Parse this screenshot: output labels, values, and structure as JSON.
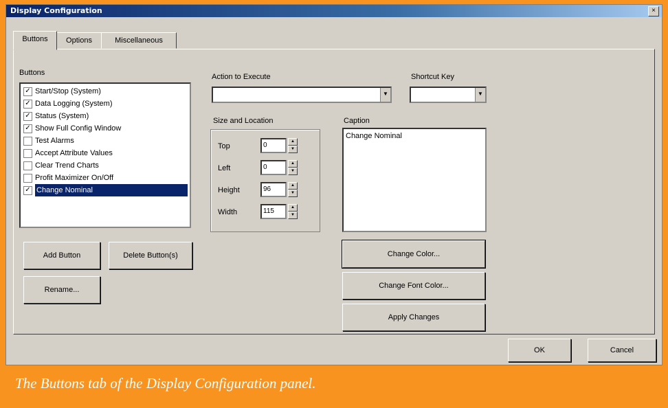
{
  "window": {
    "title": "Display Configuration",
    "close_glyph": "×"
  },
  "tabs": [
    {
      "label": "Buttons",
      "active": true
    },
    {
      "label": "Options",
      "active": false
    },
    {
      "label": "Miscellaneous",
      "active": false
    }
  ],
  "buttons_list": {
    "label": "Buttons",
    "items": [
      {
        "label": "Start/Stop (System)",
        "checked": true,
        "selected": false
      },
      {
        "label": "Data Logging (System)",
        "checked": true,
        "selected": false
      },
      {
        "label": "Status (System)",
        "checked": true,
        "selected": false
      },
      {
        "label": "Show Full Config Window",
        "checked": true,
        "selected": false
      },
      {
        "label": "Test Alarms",
        "checked": false,
        "selected": false
      },
      {
        "label": "Accept Attribute Values",
        "checked": false,
        "selected": false
      },
      {
        "label": "Clear Trend Charts",
        "checked": false,
        "selected": false
      },
      {
        "label": "Profit Maximizer On/Off",
        "checked": false,
        "selected": false
      },
      {
        "label": "Change Nominal",
        "checked": true,
        "selected": true
      }
    ]
  },
  "action": {
    "label": "Action to Execute",
    "value": ""
  },
  "shortcut": {
    "label": "Shortcut Key",
    "value": ""
  },
  "size_location": {
    "label": "Size and Location",
    "fields": [
      {
        "label": "Top",
        "value": "0"
      },
      {
        "label": "Left",
        "value": "0"
      },
      {
        "label": "Height",
        "value": "96"
      },
      {
        "label": "Width",
        "value": "115"
      }
    ]
  },
  "caption_field": {
    "label": "Caption",
    "value": "Change Nominal"
  },
  "actions": {
    "add": "Add Button",
    "delete": "Delete Button(s)",
    "rename": "Rename...",
    "change_color": "Change Color...",
    "change_font_color": "Change Font Color...",
    "apply": "Apply Changes",
    "ok": "OK",
    "cancel": "Cancel"
  },
  "figure_caption": "The Buttons tab of the Display Configuration panel."
}
